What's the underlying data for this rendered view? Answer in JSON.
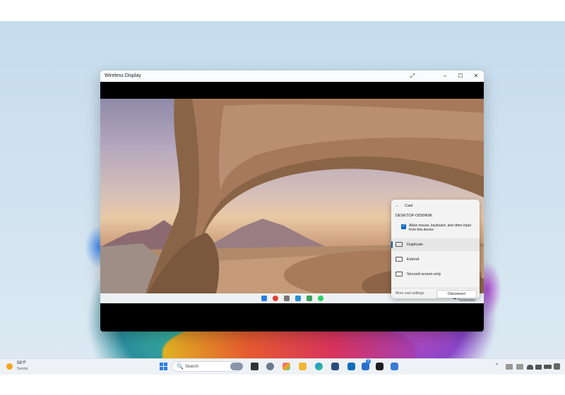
{
  "window": {
    "title": "Wireless Display",
    "controls": {
      "expand": "⤢",
      "minimize": "–",
      "maximize": "☐",
      "close": "✕"
    }
  },
  "cast_panel": {
    "back": "←",
    "title": "Cast",
    "device": "DESKTOP-O050R9K",
    "allow_input": "Allow mouse, keyboard, and other input from this device",
    "options": [
      {
        "label": "Duplicate",
        "selected": true
      },
      {
        "label": "Extend",
        "selected": false
      },
      {
        "label": "Second screen only",
        "selected": false
      }
    ],
    "more_settings": "More cast settings",
    "disconnect": "Disconnect"
  },
  "inner_taskbar": {
    "clock_time": "2:34 PM",
    "clock_date": "10/26/2024",
    "tray": "^ ☁ ))"
  },
  "taskbar": {
    "weather_temp": "58°F",
    "weather_condition": "Sunny",
    "search_placeholder": "Search",
    "search_icon": "🔍",
    "tray": "^",
    "notification_badge": "2"
  },
  "colors": {
    "accent": "#0067c0",
    "start_blue": "#2b7de9"
  }
}
